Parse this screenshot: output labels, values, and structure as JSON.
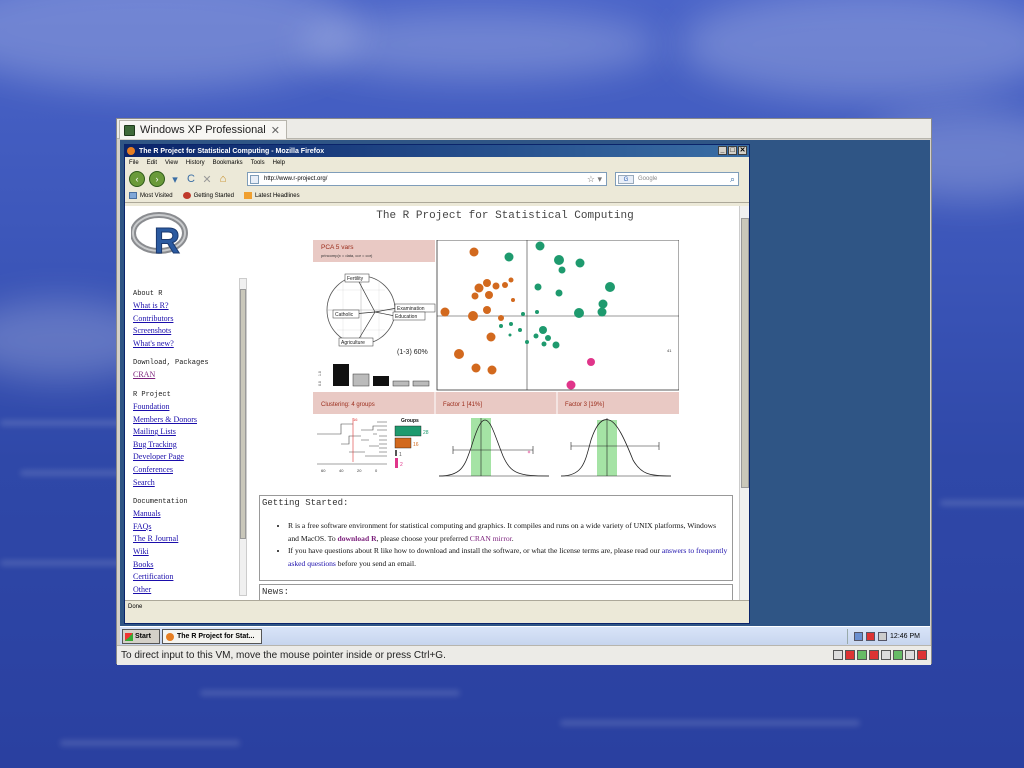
{
  "vm": {
    "tab_title": "Windows XP Professional",
    "tab_close": "✕",
    "status_text": "To direct input to this VM, move the mouse pointer inside or press Ctrl+G."
  },
  "firefox": {
    "window_title": "The R Project for Statistical Computing - Mozilla Firefox",
    "window_buttons": [
      "_",
      "□",
      "✕"
    ],
    "menu": [
      "File",
      "Edit",
      "View",
      "History",
      "Bookmarks",
      "Tools",
      "Help"
    ],
    "nav": {
      "back": "‹",
      "forward": "›",
      "dropdown": "▾",
      "reload": "C",
      "stop": "✕",
      "home": "⌂"
    },
    "url": "http://www.r-project.org/",
    "search_engine": "G",
    "search_placeholder": "Google",
    "bookmarks": [
      "Most Visited",
      "Getting Started",
      "Latest Headlines"
    ],
    "status": "Done"
  },
  "page": {
    "title": "The R Project for Statistical Computing",
    "sidebar": [
      {
        "heading": "About R",
        "links": [
          "What is R?",
          "Contributors",
          "Screenshots",
          "What's new?"
        ]
      },
      {
        "heading": "Download, Packages",
        "links": [
          "CRAN"
        ]
      },
      {
        "heading": "R Project",
        "links": [
          "Foundation",
          "Members & Donors",
          "Mailing Lists",
          "Bug Tracking",
          "Developer Page",
          "Conferences",
          "Search"
        ]
      },
      {
        "heading": "Documentation",
        "links": [
          "Manuals",
          "FAQs",
          "The R Journal",
          "Wiki",
          "Books",
          "Certification",
          "Other"
        ]
      }
    ],
    "figure": {
      "pca_label": "PCA 5 vars",
      "pca_sub": "princomp(x = data, cor = cor)",
      "biplot_labels": [
        "Fertility",
        "Catholic",
        "Examination",
        "Education",
        "Agriculture"
      ],
      "variance_label": "(1-3) 60%",
      "scree_ticks": [
        "1.0",
        "0.0"
      ],
      "scatter_corner": "41",
      "bottom_labels": [
        "Clustering: 4 groups",
        "Factor 1 [41%]",
        "Factor 3 [19%]"
      ],
      "groups_title": "Groups",
      "groups": [
        "28",
        "16",
        "1",
        "2"
      ],
      "dendro_axis": [
        "60",
        "40",
        "20",
        "0"
      ],
      "dendro_marker": "16"
    },
    "getting_started": {
      "heading": "Getting Started:",
      "item1": {
        "t1": "R is a free software environment for statistical computing and graphics. It compiles and runs on a wide variety of UNIX platforms, Windows and MacOS. To ",
        "link1": "download R",
        "t2": ", please choose your preferred ",
        "link2": "CRAN mirror",
        "t3": "."
      },
      "item2": {
        "t1": "If you have questions about R like how to download and install the software, or what the license terms are, please read our ",
        "link1": "answers to frequently asked questions",
        "t2": " before you send an email."
      }
    },
    "news_heading": "News:"
  },
  "taskbar": {
    "start": "Start",
    "task": "The R Project for Stat...",
    "clock": "12:46 PM"
  },
  "colors": {
    "orange": "#d2691e",
    "green": "#1e9a6e",
    "magenta": "#e0358a",
    "panel": "#e9c9c4",
    "panel_text": "#9a2b1a"
  }
}
